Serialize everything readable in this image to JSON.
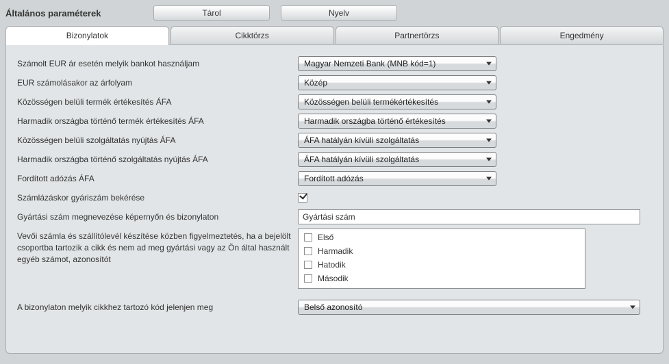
{
  "header": {
    "title": "Általános paraméterek",
    "save_label": "Tárol",
    "language_label": "Nyelv"
  },
  "tabs": [
    {
      "label": "Bizonylatok",
      "active": true
    },
    {
      "label": "Cikktörzs",
      "active": false
    },
    {
      "label": "Partnertörzs",
      "active": false
    },
    {
      "label": "Engedmény",
      "active": false
    }
  ],
  "form": {
    "row_bank": {
      "label": "Számolt EUR ár esetén melyik bankot használjam",
      "value": "Magyar Nemzeti Bank (MNB kód=1)"
    },
    "row_rate": {
      "label": "EUR számolásakor  az árfolyam",
      "value": "Közép"
    },
    "row_eu_product_vat": {
      "label": "Közösségen belüli termék értékesítés ÁFA",
      "value": "Közösségen belüli termékértékesítés"
    },
    "row_third_product_vat": {
      "label": "Harmadik országba történő termék értékesítés ÁFA",
      "value": "Harmadik országba történő értékesítés"
    },
    "row_eu_service_vat": {
      "label": "Közösségen belüli szolgáltatás nyújtás ÁFA",
      "value": "ÁFA hatályán kívüli szolgáltatás"
    },
    "row_third_service_vat": {
      "label": "Harmadik országba történő szolgáltatás nyújtás  ÁFA",
      "value": "ÁFA hatályán kívüli szolgáltatás"
    },
    "row_reverse_vat": {
      "label": "Fordított adózás ÁFA",
      "value": "Fordított adózás"
    },
    "row_serial_prompt": {
      "label": "Számlázáskor gyáriszám bekérése",
      "checked": true
    },
    "row_serial_name": {
      "label": "Gyártási szám megnevezése képernyőn és bizonylaton",
      "value": "Gyártási szám"
    },
    "row_warn_groups": {
      "label": "Vevői számla és szállítólevél készítése közben figyelmeztetés, ha a bejelölt csoportba tartozik a cikk és nem ad meg gyártási vagy az Ön által használt egyéb számot, azonosítót",
      "items": [
        "Első",
        "Harmadik",
        "Hatodik",
        "Második"
      ]
    },
    "row_item_code": {
      "label": "A bizonylaton melyik cikkhez tartozó kód jelenjen meg",
      "value": "Belső azonosító"
    }
  }
}
